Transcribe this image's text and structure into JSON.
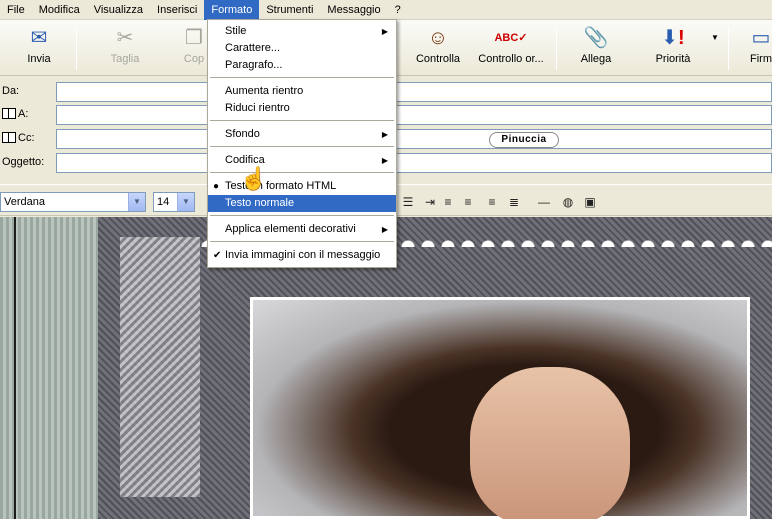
{
  "menubar": [
    "File",
    "Modifica",
    "Visualizza",
    "Inserisci",
    "Formato",
    "Strumenti",
    "Messaggio",
    "?"
  ],
  "toolbar": {
    "invia": "Invia",
    "taglia": "Taglia",
    "copia": "Cop",
    "controlla": "Controlla",
    "controllo_ortografia": "Controllo or...",
    "allega": "Allega",
    "priorita": "Priorità",
    "firma": "Firm"
  },
  "header": {
    "da": "Da:",
    "a": "A:",
    "cc": "Cc:",
    "oggetto": "Oggetto:",
    "cc_chip": "Pinuccia"
  },
  "format_bar": {
    "font": "Verdana",
    "size": "14"
  },
  "formato_menu": {
    "stile": "Stile",
    "carattere": "Carattere...",
    "paragrafo": "Paragrafo...",
    "aumenta_rientro": "Aumenta rientro",
    "riduci_rientro": "Riduci rientro",
    "sfondo": "Sfondo",
    "codifica": "Codifica",
    "testo_html": "Testo in formato HTML",
    "testo_normale": "Testo normale",
    "applica_elementi": "Applica elementi decorativi",
    "invia_immagini": "Invia immagini con il messaggio"
  },
  "colors": {
    "menu_highlight": "#316ac5",
    "chrome": "#ece9d8"
  }
}
